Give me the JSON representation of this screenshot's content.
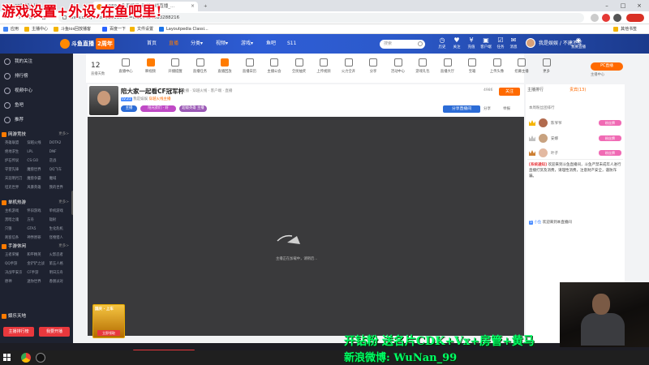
{
  "overlay": {
    "top_text": "游戏设置+外设,在鱼吧里!",
    "bottom_line1": "开钻粉 送名片CDK+Vx+房管+黄马",
    "bottom_line2": "新浪微博: WuNan_99"
  },
  "browser": {
    "tabs": [
      {
        "label": "CF穿越火线..."
      },
      {
        "label": "6989斗鱼直播间_穿越火线直播_..."
      }
    ],
    "address": "www.douyu.com/16969?...=0.897494683288216",
    "bookmarks": [
      "应用",
      "主播中心",
      "斗鱼ios回放播客",
      "百度一下",
      "文件设置",
      "Layoutpedia Classi..."
    ],
    "bookmark_right": "其他书签"
  },
  "header": {
    "logo_text": "斗鱼直播",
    "logo_badge": "2周年",
    "nav": [
      {
        "label": "首页",
        "active": false
      },
      {
        "label": "直播",
        "active": true
      },
      {
        "label": "分类▾",
        "active": false
      },
      {
        "label": "视频▾",
        "active": false
      },
      {
        "label": "游戏▾",
        "active": false
      },
      {
        "label": "鱼吧",
        "active": false
      },
      {
        "label": "S11",
        "active": false
      }
    ],
    "search_placeholder": "搜索",
    "icons": [
      {
        "icon": "history-icon",
        "label": "历史"
      },
      {
        "icon": "follow-icon",
        "label": "关注"
      },
      {
        "icon": "charge-icon",
        "label": "充值"
      },
      {
        "icon": "app-icon",
        "label": "客户端"
      },
      {
        "icon": "task-icon",
        "label": "任务"
      },
      {
        "icon": "message-icon",
        "label": "消息"
      },
      {
        "icon": "live-icon",
        "label": "我要直播"
      }
    ],
    "username": "我是娱娱 / 不建不立"
  },
  "sidebar": {
    "items": [
      {
        "icon": "heart-icon",
        "label": "我的关注"
      },
      {
        "icon": "rank-icon",
        "label": "排行榜"
      },
      {
        "icon": "video-icon",
        "label": "视频中心"
      },
      {
        "icon": "fishbar-icon",
        "label": "鱼吧"
      }
    ],
    "recommend_label": "推荐",
    "sections": [
      {
        "title": "网游竞技",
        "more": "更多>",
        "games": [
          "英雄联盟",
          "穿越火线",
          "DOTA2",
          "绝地求生",
          "LPL",
          "DNF",
          "炉石传说",
          "CS:GO",
          "逆战",
          "守望先锋",
          "魔兽世界",
          "QQ飞车",
          "天涯明月刀",
          "魔兽争霸",
          "魔域",
          "坦克世界",
          "风暴英雄",
          "我的世界"
        ]
      },
      {
        "title": "单机热游",
        "more": "更多>",
        "games": [
          "主机游戏",
          "怀旧游戏",
          "单机游戏",
          "黑暗之魂",
          "方舟",
          "辐射",
          "只狼",
          "GTA5",
          "生化危机",
          "刺客信条",
          "神界原罪",
          "怪物猎人"
        ]
      },
      {
        "title": "手游休闲",
        "more": "更多>",
        "games": [
          "王者荣耀",
          "和平精英",
          "火影忍者",
          "QQ手游",
          "金铲铲之战",
          "第五人格",
          "决战平安京",
          "CF手游",
          "明日方舟",
          "原神",
          "迷你世界",
          "香肠派对"
        ]
      }
    ],
    "last_section": "娱乐天地",
    "btn_rank": "主播排行榜",
    "btn_fav": "我要开播"
  },
  "category_strip": {
    "count": "12",
    "count_label": "直播天数",
    "items": [
      "直播中心",
      "瞬视频",
      "开播提醒",
      "直播任务",
      "直播回放",
      "直播日历",
      "主播公会",
      "全民抽奖",
      "上传视频",
      "火力全开",
      "分享",
      "活动中心",
      "游戏礼包",
      "直播大厅",
      "宝箱",
      "上传头像",
      "招募主播",
      "更多"
    ],
    "right_btn": "PC直播",
    "right_label": "主播中心"
  },
  "room": {
    "title": "陪大家一起看CF冠军杯",
    "meta": "主播 · 穿越火线 · 客户端 · 直播",
    "level": "LV.21",
    "anchor": "我是娱娱",
    "hot_tag": "穿越火线主播",
    "badges": [
      {
        "label": "主播",
        "color": "#2c6cd6"
      },
      {
        "label": "陪兄弟们 · 好",
        "color": "#c04ac6"
      },
      {
        "label": "超级英雄 主播",
        "color": "#9b59b6"
      }
    ],
    "follow_count": "4986",
    "follow_label": "关注",
    "action_label": "分享直播间",
    "share_label": "分享",
    "report_label": "举报",
    "loading_text": "主播正在加载中，请稍后..."
  },
  "promo": {
    "title": "国庆 · 上车",
    "button": "立即领取"
  },
  "right_panel": {
    "tabs": [
      {
        "label": "主播排行",
        "active": false
      },
      {
        "label": "贵宾(13)",
        "active": true
      }
    ],
    "rank_title": "本周粉丝团排行",
    "ranks": [
      {
        "name": "陈爷爷",
        "tag": "粉丝牌",
        "color": "#b26b4e"
      },
      {
        "name": "安娜",
        "tag": "粉丝牌",
        "color": "#c8a280"
      },
      {
        "name": "叶子",
        "tag": "粉丝牌",
        "color": "#e3b9a1"
      }
    ],
    "system_label": "[系统通知]",
    "system_text": "欢迎来到斗鱼直播间，斗鱼严禁未成年人进行直播打赏及消费，请理性消费，注意财产安全，谨防诈骗。",
    "chat_user": "小鱼",
    "chat_level": "5",
    "chat_text": "欢迎来到本直播间"
  }
}
